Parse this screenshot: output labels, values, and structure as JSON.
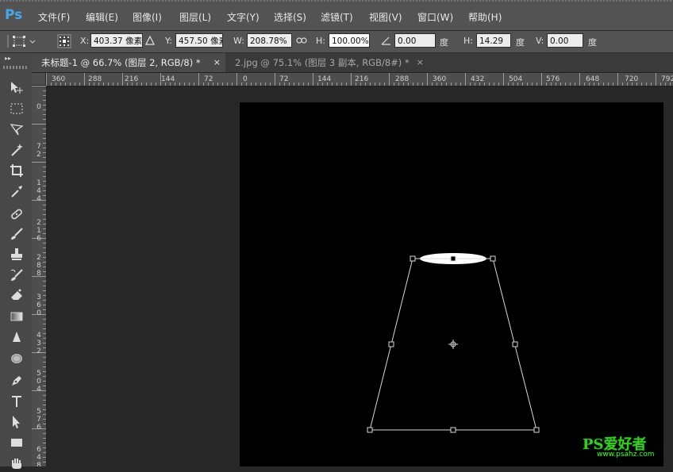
{
  "app": {
    "logo": "Ps"
  },
  "menu": [
    {
      "label": "文件(F)"
    },
    {
      "label": "编辑(E)"
    },
    {
      "label": "图像(I)"
    },
    {
      "label": "图层(L)"
    },
    {
      "label": "文字(Y)"
    },
    {
      "label": "选择(S)"
    },
    {
      "label": "滤镜(T)"
    },
    {
      "label": "视图(V)"
    },
    {
      "label": "窗口(W)"
    },
    {
      "label": "帮助(H)"
    }
  ],
  "options": {
    "x_label": "X:",
    "x_value": "403.37 像素",
    "y_label": "Y:",
    "y_value": "457.50 像素",
    "w_label": "W:",
    "w_value": "208.78%",
    "h_label": "H:",
    "h_value": "100.00%",
    "angle_value": "0.00",
    "angle_unit": "度",
    "skew_h_label": "H:",
    "skew_h_value": "14.29",
    "skew_h_unit": "度",
    "skew_v_label": "V:",
    "skew_v_value": "0.00",
    "skew_v_unit": "度"
  },
  "tabs": [
    {
      "label": "未标题-1 @ 66.7% (图层 2, RGB/8) *",
      "close": "×",
      "active": true
    },
    {
      "label": "2.jpg @ 75.1% (图层 3 副本, RGB/8#) *",
      "close": "×",
      "active": false
    }
  ],
  "ruler": {
    "h_ticks": [
      "360",
      "288",
      "216",
      "144",
      "72",
      "0",
      "72",
      "144",
      "216",
      "288",
      "360",
      "432",
      "504",
      "576",
      "648",
      "720",
      "792"
    ],
    "v_ticks": [
      "0",
      "72",
      "144",
      "216",
      "288",
      "360",
      "432",
      "504",
      "576",
      "648"
    ]
  },
  "tools": [
    {
      "icon": "move-icon"
    },
    {
      "icon": "marquee-icon"
    },
    {
      "icon": "lasso-icon"
    },
    {
      "icon": "magic-wand-icon"
    },
    {
      "icon": "crop-icon"
    },
    {
      "icon": "eyedropper-icon"
    },
    {
      "icon": "healing-brush-icon"
    },
    {
      "icon": "brush-icon"
    },
    {
      "icon": "clone-stamp-icon"
    },
    {
      "icon": "history-brush-icon"
    },
    {
      "icon": "eraser-icon"
    },
    {
      "icon": "gradient-icon"
    },
    {
      "icon": "blur-icon"
    },
    {
      "icon": "dodge-icon"
    },
    {
      "icon": "pen-icon"
    },
    {
      "icon": "type-icon"
    },
    {
      "icon": "path-selection-icon"
    },
    {
      "icon": "rectangle-icon"
    },
    {
      "icon": "hand-icon"
    }
  ],
  "watermark": {
    "text": "PS爱好者",
    "subtext": "www.psahz.com"
  },
  "colors": {
    "accent": "#4aa6e8",
    "canvas": "#000000",
    "watermark": "#41c52b"
  }
}
